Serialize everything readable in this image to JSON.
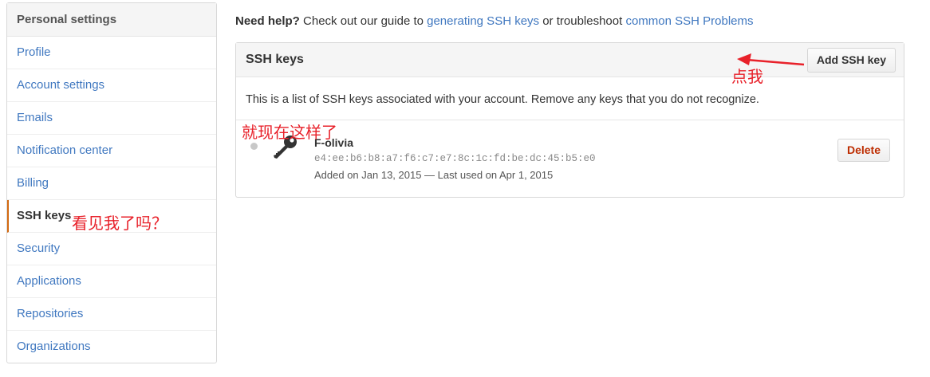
{
  "sidebar": {
    "header": "Personal settings",
    "items": [
      {
        "label": "Profile"
      },
      {
        "label": "Account settings"
      },
      {
        "label": "Emails"
      },
      {
        "label": "Notification center"
      },
      {
        "label": "Billing"
      },
      {
        "label": "SSH keys",
        "selected": true
      },
      {
        "label": "Security"
      },
      {
        "label": "Applications"
      },
      {
        "label": "Repositories"
      },
      {
        "label": "Organizations"
      }
    ]
  },
  "help": {
    "prefix": "Need help?",
    "text1": " Check out our guide to ",
    "link1": "generating SSH keys",
    "text2": " or troubleshoot ",
    "link2": "common SSH Problems"
  },
  "panel": {
    "title": "SSH keys",
    "add_button": "Add SSH key",
    "description": "This is a list of SSH keys associated with your account. Remove any keys that you do not recognize.",
    "key": {
      "title": "F-olivia",
      "fingerprint": "e4:ee:b6:b8:a7:f6:c7:e7:8c:1c:fd:be:dc:45:b5:e0",
      "meta": "Added on Jan 13, 2015 — Last used on Apr 1, 2015",
      "delete_button": "Delete"
    }
  },
  "annotations": {
    "click_me": "点我",
    "like_this": "就现在这样了",
    "see_me": "看见我了吗？"
  },
  "colors": {
    "link": "#4078c0",
    "selected_border": "#d26911",
    "delete_text": "#bd2c00",
    "annotation": "#e8212a"
  },
  "icons": {
    "key": "key-icon",
    "status": "status-dot-icon",
    "arrow": "arrow-left-icon"
  }
}
